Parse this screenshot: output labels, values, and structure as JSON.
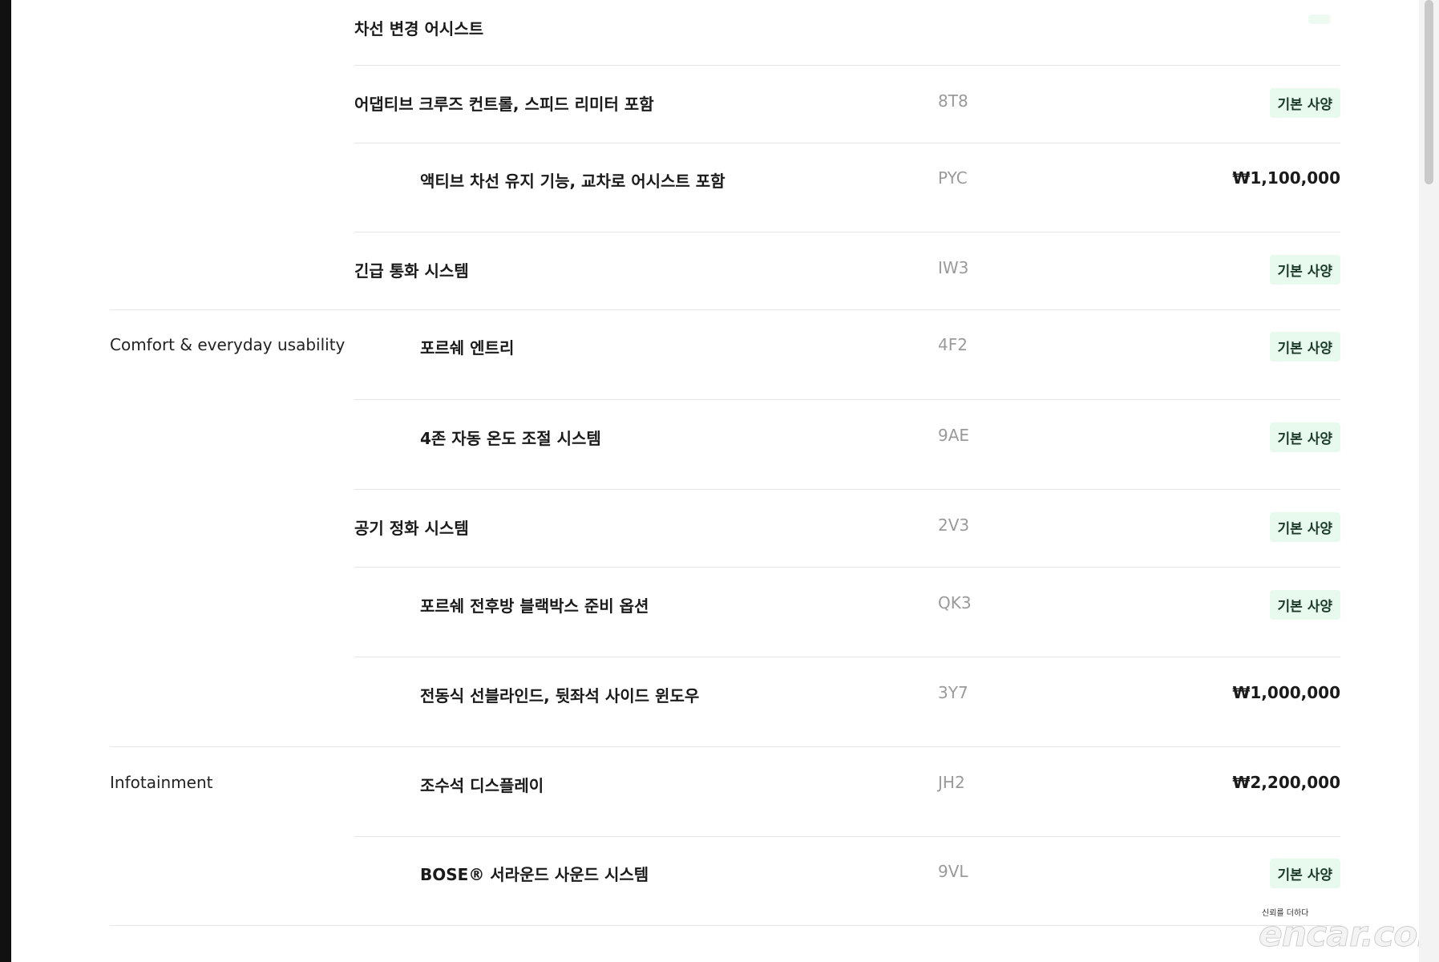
{
  "rows": [
    {
      "category": "",
      "name": "차선 변경 어시스트",
      "code": "",
      "price": "",
      "badge": ""
    },
    {
      "category": "",
      "name": "어댑티브 크루즈 컨트롤, 스피드 리미터 포함",
      "code": "8T8",
      "price": "",
      "badge": "기본 사양"
    },
    {
      "category": "",
      "name": "액티브 차선 유지 기능, 교차로 어시스트 포함",
      "code": "PYC",
      "price": "₩1,100,000",
      "badge": ""
    },
    {
      "category": "",
      "name": "긴급 통화 시스템",
      "code": "IW3",
      "price": "",
      "badge": "기본 사양"
    },
    {
      "category": "Comfort & everyday usability",
      "name": "포르쉐 엔트리",
      "code": "4F2",
      "price": "",
      "badge": "기본 사양"
    },
    {
      "category": "",
      "name": "4존 자동 온도 조절 시스템",
      "code": "9AE",
      "price": "",
      "badge": "기본 사양"
    },
    {
      "category": "",
      "name": "공기 정화 시스템",
      "code": "2V3",
      "price": "",
      "badge": "기본 사양"
    },
    {
      "category": "",
      "name": "포르쉐 전후방 블랙박스 준비 옵션",
      "code": "QK3",
      "price": "",
      "badge": "기본 사양"
    },
    {
      "category": "",
      "name": "전동식 선블라인드, 뒷좌석 사이드 윈도우",
      "code": "3Y7",
      "price": "₩1,000,000",
      "badge": ""
    },
    {
      "category": "Infotainment",
      "name": "조수석 디스플레이",
      "code": "JH2",
      "price": "₩2,200,000",
      "badge": ""
    },
    {
      "category": "",
      "name": "BOSE® 서라운드 사운드 시스템",
      "code": "9VL",
      "price": "",
      "badge": "기본 사양"
    }
  ],
  "watermark": {
    "tagline": "신뢰를 더하다",
    "brand": "encar.com"
  }
}
